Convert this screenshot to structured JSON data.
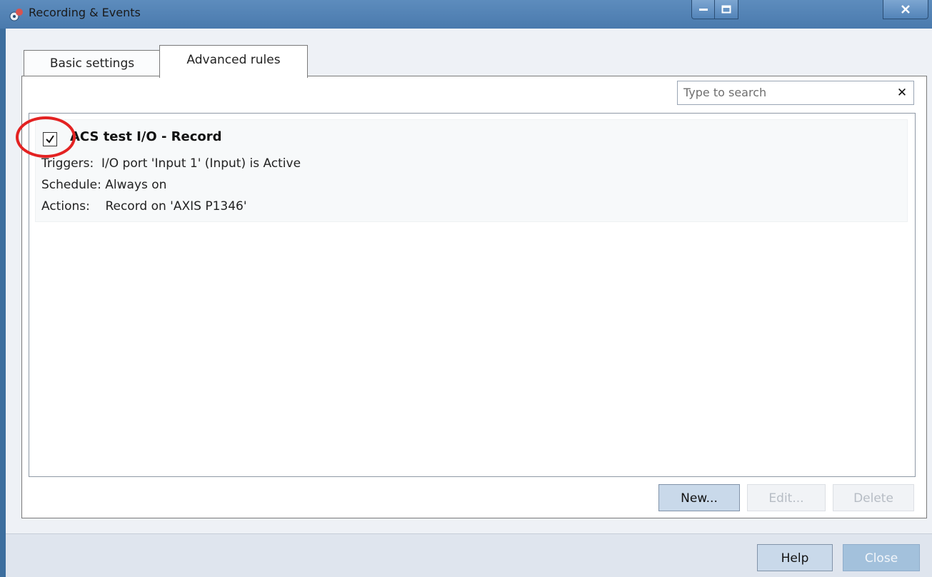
{
  "window": {
    "title": "Recording & Events",
    "controls": [
      "minimize",
      "maximize",
      "close"
    ]
  },
  "tabs": [
    {
      "label": "Basic settings",
      "selected": false
    },
    {
      "label": "Advanced rules",
      "selected": true
    }
  ],
  "search": {
    "placeholder": "Type to search",
    "value": "",
    "clear_label": "✕"
  },
  "rules": [
    {
      "checked": true,
      "title": "ACS test I/O - Record",
      "triggers_label": "Triggers:",
      "triggers_value": "I/O port 'Input 1' (Input) is Active",
      "schedule_label": "Schedule:",
      "schedule_value": "Always on",
      "actions_label": "Actions:",
      "actions_value": "Record on 'AXIS P1346'"
    }
  ],
  "rule_buttons": {
    "new": "New...",
    "edit": "Edit...",
    "delete": "Delete"
  },
  "footer_buttons": {
    "help": "Help",
    "close": "Close"
  },
  "colors": {
    "titlebar": "#4a7aad",
    "highlight_ring": "#e32222",
    "primary_button": "#c9d9ea"
  }
}
